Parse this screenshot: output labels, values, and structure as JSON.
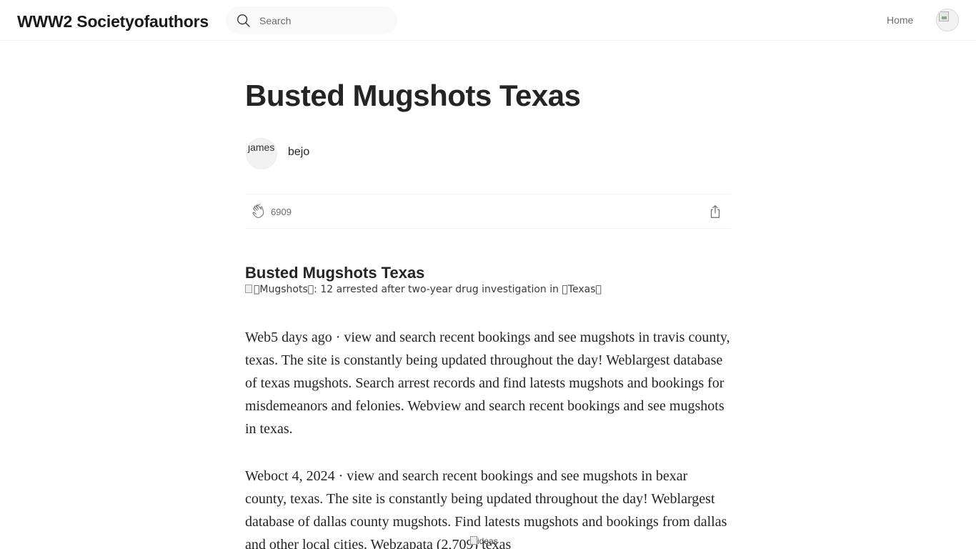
{
  "header": {
    "brand": "WWW2 Societyofauthors",
    "search_placeholder": "Search",
    "nav_home": "Home",
    "icons": {
      "search": "search-icon",
      "user": "user-avatar-icon"
    }
  },
  "article": {
    "title": "Busted Mugshots Texas",
    "author": {
      "avatar_alt": "james",
      "name": "bejo"
    },
    "claps": "6909",
    "section_heading": "Busted Mugshots Texas",
    "image_alt": "\u0000Mugshots\u0000: 12 arrested after two-year drug investigation in \u0000Texas\u0000",
    "paragraphs": [
      "Web5 days ago · view and search recent bookings and see mugshots in travis county, texas. The site is constantly being updated throughout the day! Weblargest database of texas mugshots. Search arrest records and find latests mugshots and bookings for misdemeanors and felonies. Webview and search recent bookings and see mugshots in texas.",
      "Weboct 4, 2024 · view and search recent bookings and see mugshots in bexar county, texas. The site is constantly being updated throughout the day! Weblargest database of dallas county mugshots. Find latests mugshots and bookings from dallas and other local cities. Webzapata (2,709) texas"
    ],
    "inline_image_alt": "ideas",
    "icons": {
      "clap": "clap-icon",
      "share": "share-icon"
    }
  }
}
